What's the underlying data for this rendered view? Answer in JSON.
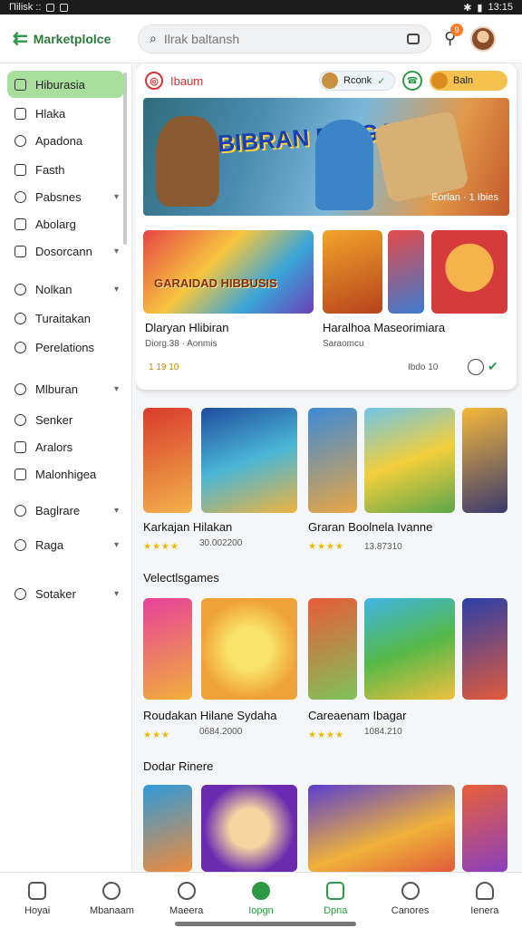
{
  "status_bar": {
    "left": "Πilisk ::",
    "right": "13:15"
  },
  "header": {
    "app_name": "Marketplolce",
    "search_placeholder": "Ilrak baltansh",
    "notification_count": "9"
  },
  "sidebar": {
    "items": [
      {
        "label": "Hiburasia",
        "active": true
      },
      {
        "label": "Hlaka"
      },
      {
        "label": "Apadona"
      },
      {
        "label": "Fasth"
      },
      {
        "label": "Pabsnes",
        "expandable": true
      },
      {
        "label": "Abolarg"
      },
      {
        "label": "Dosorcann",
        "expandable": true
      },
      {
        "label": "Nolkan",
        "expandable": true
      },
      {
        "label": "Turaitakan"
      },
      {
        "label": "Perelations"
      },
      {
        "label": "Mlburan",
        "expandable": true
      },
      {
        "label": "Senker"
      },
      {
        "label": "Aralors"
      },
      {
        "label": "Malonhigea"
      },
      {
        "label": "Baglrare",
        "expandable": true
      },
      {
        "label": "Raga",
        "expandable": true
      },
      {
        "label": "Sotaker",
        "expandable": true
      }
    ]
  },
  "featured": {
    "header_label": "Ibaum",
    "pill_a": "Rconk",
    "pill_b": "Baln",
    "banner_title": "BIBRAN DILIGAN",
    "banner_meta": "Eorlan · 1 Ibies",
    "game_a": {
      "title": "Dlaryan Hlibiran",
      "sub": "Diorg.38 · Aonmis",
      "rating": "1 19 10"
    },
    "game_b": {
      "title": "Haralhoa Maseorimiara",
      "sub": "Saraomcu",
      "rating": "Ibdo 10"
    },
    "thumb_a_text": "GARAIDAD HIBBUSIS"
  },
  "sections": [
    {
      "title": "",
      "cards": [
        {
          "title": "Karkajan Hilakan",
          "sub": "30.002200",
          "stars": "★★★★"
        },
        {
          "title": "Graran Boolnela Ivanne",
          "sub": "13.87310",
          "stars": "★★★★"
        }
      ]
    },
    {
      "title": "Velectlsgames",
      "cards": [
        {
          "title": "Roudakan Hilane Sydaha",
          "sub": "0684.2000",
          "stars": "★★★"
        },
        {
          "title": "Careaenam Ibagar",
          "sub": "1084.210",
          "stars": "★★★★"
        }
      ]
    },
    {
      "title": "Dodar Rinere",
      "cards": []
    }
  ],
  "bottom_nav": [
    {
      "label": "Hoyai"
    },
    {
      "label": "Mbanaam"
    },
    {
      "label": "Maeera"
    },
    {
      "label": "Iopgn",
      "active": true
    },
    {
      "label": "Dpna",
      "green": true
    },
    {
      "label": "Canores"
    },
    {
      "label": "Ienera"
    }
  ],
  "colors": {
    "accent": "#2e9a47",
    "active_bg": "#a8df9c",
    "star": "#f2b705"
  }
}
